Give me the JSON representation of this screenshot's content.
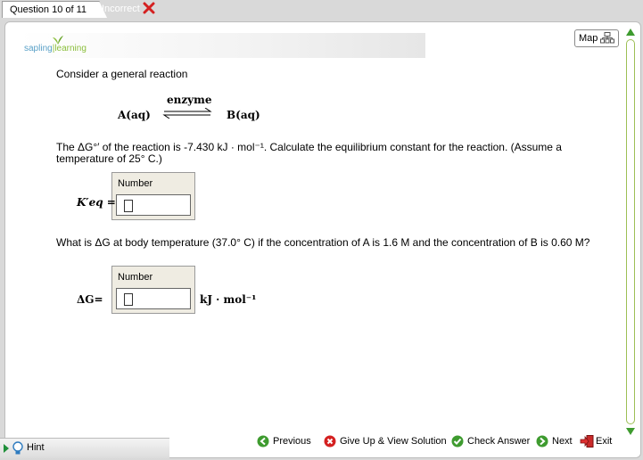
{
  "tabs": {
    "active": "Question 10 of 11",
    "status": "Incorrect"
  },
  "brand": {
    "text_part1": "sapling",
    "text_part2": "learning"
  },
  "map_button": "Map",
  "question": {
    "intro": "Consider a general reaction",
    "reaction": {
      "catalyst": "enzyme",
      "reactant": "A(aq)",
      "product": "B(aq)"
    },
    "prompt1": "The ΔG°′ of the reaction is -7.430 kJ · mol⁻¹. Calculate the equilibrium constant for the reaction. (Assume a temperature of 25° C.)",
    "box1_label": "Number",
    "keq_label": "K′eq =",
    "prompt2": "What is ΔG at body temperature (37.0° C) if the concentration of A is 1.6 M and the concentration of B is 0.60 M?",
    "box2_label": "Number",
    "dg_label": "ΔG=",
    "unit": "kJ · mol⁻¹"
  },
  "nav": {
    "previous": "Previous",
    "give_up": "Give Up & View Solution",
    "check": "Check Answer",
    "next": "Next",
    "exit": "Exit"
  },
  "hint": "Hint",
  "icons": [
    "x-icon",
    "map-icon",
    "scroll-up-icon",
    "scroll-down-icon",
    "previous-icon",
    "give-up-icon",
    "check-icon",
    "next-icon",
    "exit-icon",
    "hint-bulb-icon"
  ]
}
